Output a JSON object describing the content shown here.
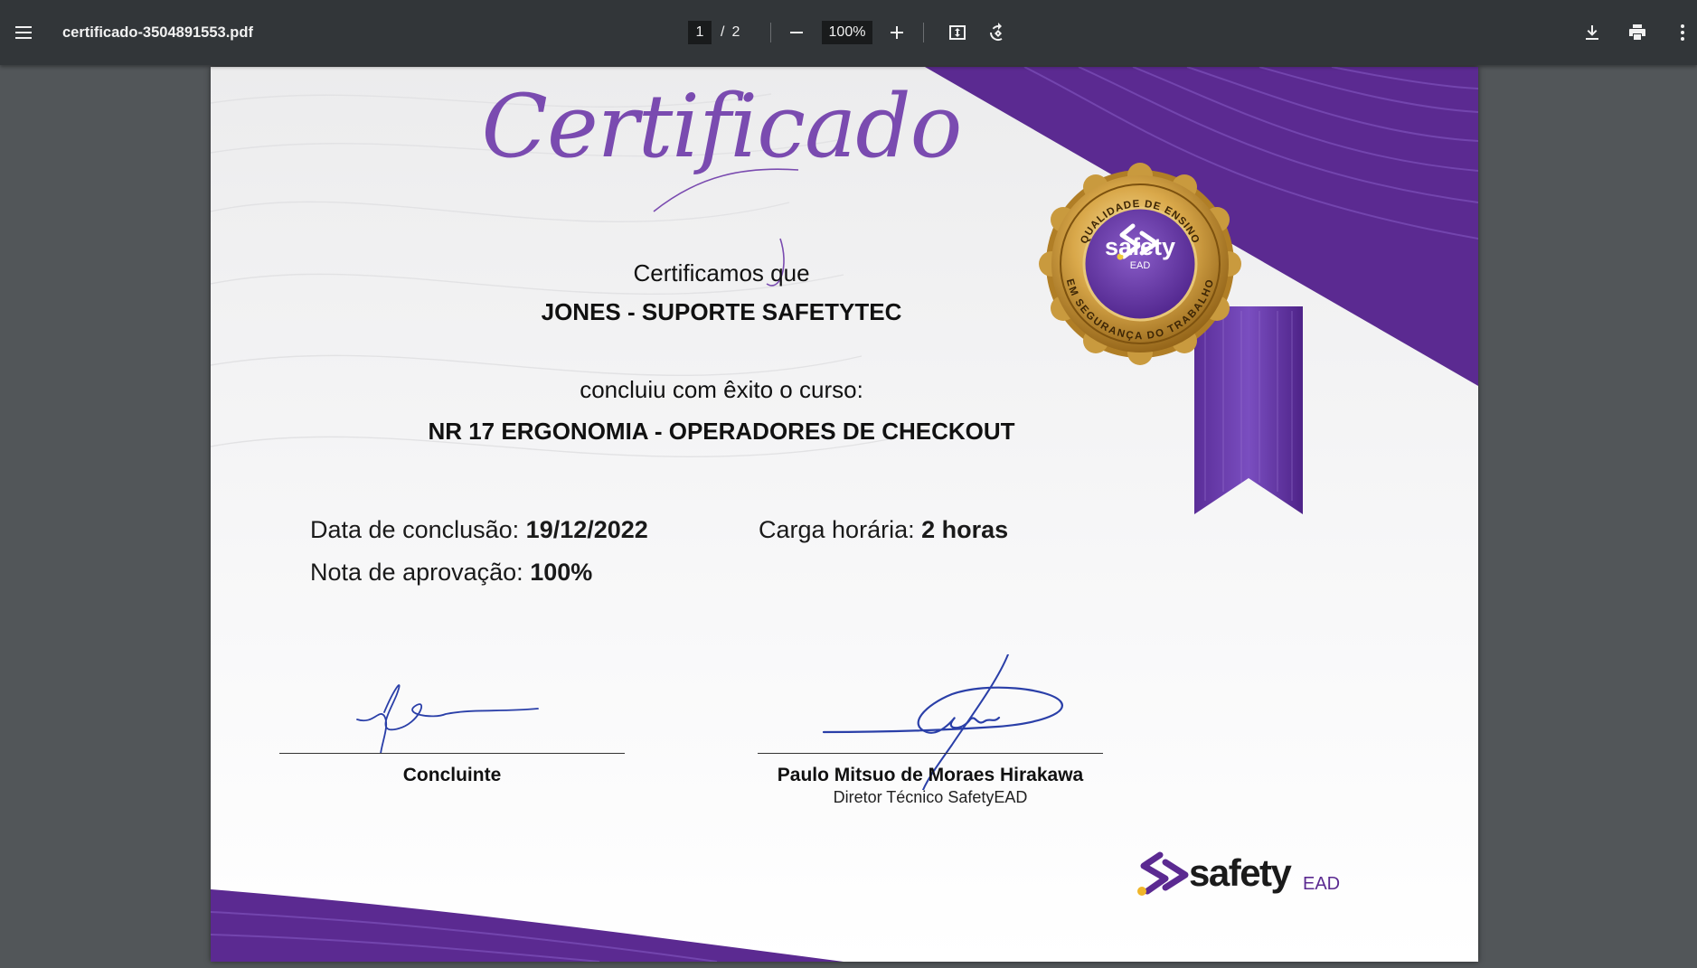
{
  "toolbar": {
    "menu_icon": "hamburger-menu-icon",
    "filename": "certificado-3504891553.pdf",
    "current_page": "1",
    "page_separator": "/",
    "total_pages": "2",
    "zoom": "100%",
    "icons": {
      "zoom_out": "minus-icon",
      "zoom_in": "plus-icon",
      "fit": "fit-to-page-icon",
      "rotate": "rotate-icon",
      "download": "download-icon",
      "print": "print-icon",
      "more": "more-vert-icon"
    }
  },
  "certificate": {
    "heading": "Certificado",
    "intro": "Certificamos que",
    "recipient": "JONES - SUPORTE SAFETYTEC",
    "course_intro": "concluiu com êxito o curso:",
    "course": "NR 17 ERGONOMIA - OPERADORES DE CHECKOUT",
    "completion_label": "Data de conclusão:",
    "completion_value": "19/12/2022",
    "workload_label": "Carga horária:",
    "workload_value": "2 horas",
    "grade_label": "Nota de aprovação:",
    "grade_value": "100%",
    "signature_left_label": "Concluinte",
    "signature_right_name": "Paulo Mitsuo de Moraes Hirakawa",
    "signature_right_title": "Diretor Técnico SafetyEAD",
    "seal": {
      "top_arc": "QUALIDADE DE ENSINO",
      "bottom_arc": "EM SEGURANÇA DO TRABALHO",
      "brand": "safety",
      "brand_sub": "EAD"
    },
    "footer_logo": {
      "brand": "safety",
      "brand_sub": "EAD"
    }
  },
  "colors": {
    "toolbar_bg": "#323639",
    "viewer_bg": "#525659",
    "brand_purple": "#5b2a91",
    "heading_purple": "#7a4bb0",
    "gold": "#c9962e",
    "signature_blue": "#2a3fa8"
  }
}
